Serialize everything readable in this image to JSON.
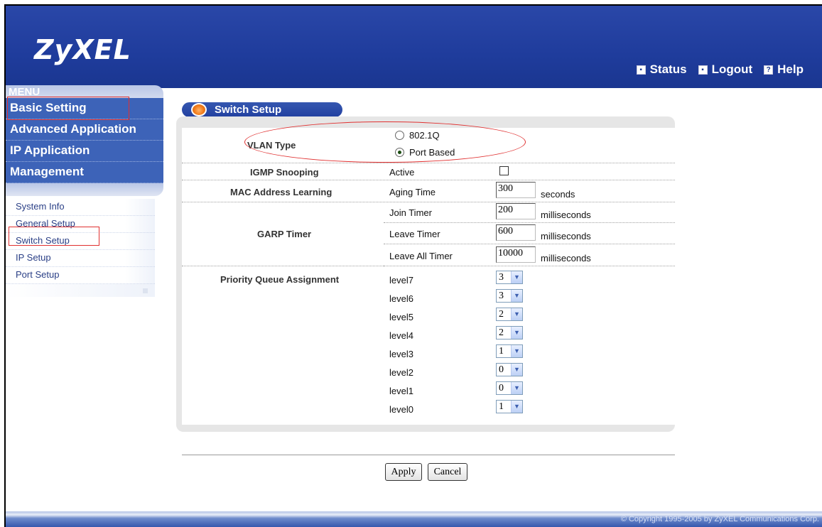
{
  "header": {
    "logo": "ZyXEL",
    "links": [
      {
        "label": "Status",
        "icon": "status-icon"
      },
      {
        "label": "Logout",
        "icon": "logout-icon"
      },
      {
        "label": "Help",
        "icon": "help-icon"
      }
    ]
  },
  "sidebar": {
    "menu_title": "MENU",
    "menu_items": [
      "Basic Setting",
      "Advanced Application",
      "IP Application",
      "Management"
    ],
    "sub_items": [
      "System Info",
      "General Setup",
      "Switch Setup",
      "IP Setup",
      "Port Setup"
    ],
    "active_menu": "Basic Setting",
    "active_sub": "Switch Setup"
  },
  "page": {
    "title": "Switch Setup",
    "vlan": {
      "label": "VLAN Type",
      "options": [
        "802.1Q",
        "Port Based"
      ],
      "selected": "Port Based"
    },
    "igmp": {
      "label": "IGMP Snooping",
      "text": "Active",
      "checked": false
    },
    "mac": {
      "label": "MAC Address Learning",
      "field": "Aging Time",
      "value": "300",
      "unit": "seconds"
    },
    "garp": {
      "label": "GARP Timer",
      "rows": [
        {
          "field": "Join Timer",
          "value": "200",
          "unit": "milliseconds"
        },
        {
          "field": "Leave Timer",
          "value": "600",
          "unit": "milliseconds"
        },
        {
          "field": "Leave All Timer",
          "value": "10000",
          "unit": "milliseconds"
        }
      ]
    },
    "priority": {
      "label": "Priority Queue Assignment",
      "levels": [
        {
          "level": "level7",
          "value": "3"
        },
        {
          "level": "level6",
          "value": "3"
        },
        {
          "level": "level5",
          "value": "2"
        },
        {
          "level": "level4",
          "value": "2"
        },
        {
          "level": "level3",
          "value": "1"
        },
        {
          "level": "level2",
          "value": "0"
        },
        {
          "level": "level1",
          "value": "0"
        },
        {
          "level": "level0",
          "value": "1"
        }
      ]
    },
    "buttons": {
      "apply": "Apply",
      "cancel": "Cancel"
    }
  },
  "footer": {
    "copyright": "© Copyright 1995-2005 by ZyXEL Communications Corp."
  },
  "colors": {
    "header_blue": "#1f3c9c",
    "menu_blue": "#3d63b8",
    "highlight_red": "#e03030",
    "accent_orange": "#f07a1a"
  }
}
